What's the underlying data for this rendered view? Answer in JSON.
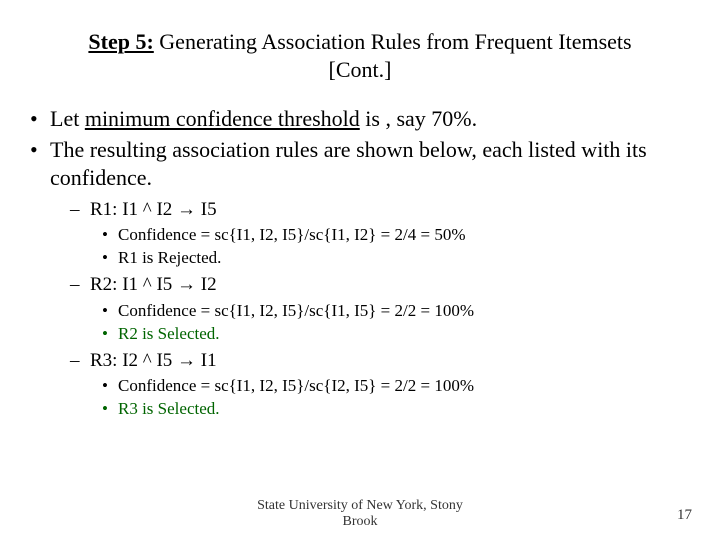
{
  "title": {
    "step": "Step 5:",
    "rest": " Generating Association Rules from Frequent Itemsets [Cont.]"
  },
  "bullets": {
    "b1_pre": "Let ",
    "b1_uln": "minimum confidence threshold",
    "b1_post": " is , say 70%.",
    "b2": "The resulting association rules are shown below, each listed with its confidence."
  },
  "rules": {
    "r1": {
      "head": "R1: I1 ^ I2 → I5",
      "conf": "Confidence = sc{I1, I2, I5}/sc{I1, I2} = 2/4 = 50%",
      "verdict": "R1 is Rejected."
    },
    "r2": {
      "head": "R2: I1 ^ I5 → I2",
      "conf": "Confidence = sc{I1, I2, I5}/sc{I1, I5} = 2/2 = 100%",
      "verdict": "R2 is Selected."
    },
    "r3": {
      "head": "R3: I2 ^ I5 → I1",
      "conf": "Confidence = sc{I1, I2, I5}/sc{I2, I5} = 2/2 = 100%",
      "verdict": "R3 is Selected."
    }
  },
  "footer": {
    "line1": "State University of New York, Stony",
    "line2": "Brook"
  },
  "page": "17"
}
